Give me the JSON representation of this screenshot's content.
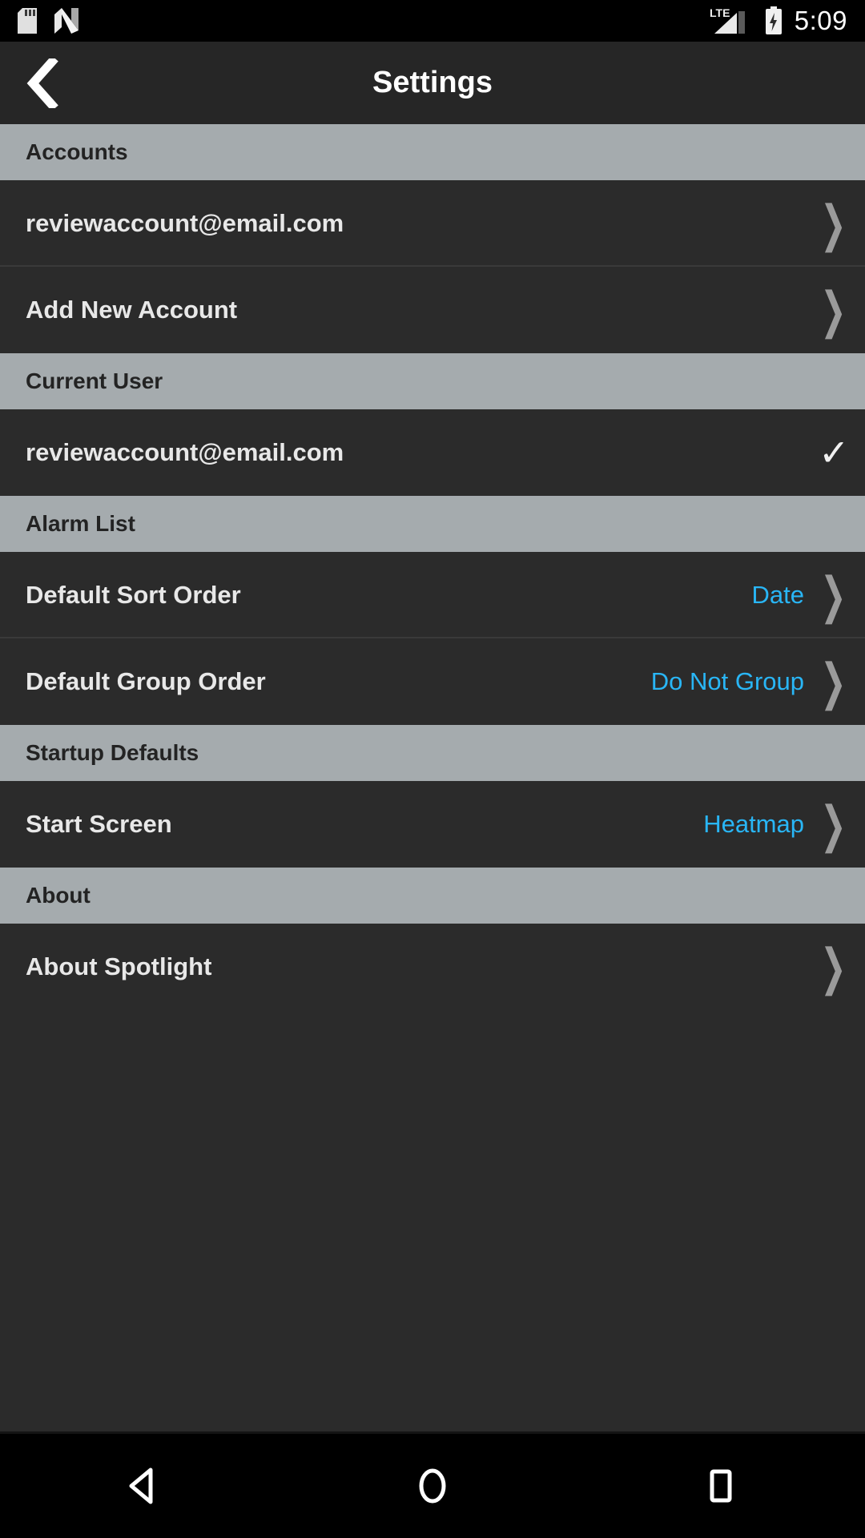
{
  "status_bar": {
    "time": "5:09",
    "icons": [
      "sd-card-icon",
      "android-nougat-icon",
      "lte-signal-icon",
      "battery-charging-icon"
    ],
    "network_label": "LTE"
  },
  "app_bar": {
    "back_label": "‹",
    "title": "Settings"
  },
  "colors": {
    "accent_blue": "#29b6f6",
    "section_header_bg": "#a5abae",
    "row_bg": "#2b2b2b",
    "appbar_bg": "#262626"
  },
  "sections": [
    {
      "header": "Accounts",
      "rows": [
        {
          "title": "reviewaccount@email.com",
          "value": "",
          "accessory": "chevron",
          "glyph": "❯"
        },
        {
          "title": "Add New Account",
          "value": "",
          "accessory": "chevron",
          "glyph": "❯"
        }
      ]
    },
    {
      "header": "Current User",
      "rows": [
        {
          "title": "reviewaccount@email.com",
          "value": "",
          "accessory": "check",
          "glyph": "✓"
        }
      ]
    },
    {
      "header": "Alarm List",
      "rows": [
        {
          "title": "Default Sort Order",
          "value": "Date",
          "accessory": "chevron",
          "glyph": "❯"
        },
        {
          "title": "Default Group Order",
          "value": "Do Not Group",
          "accessory": "chevron",
          "glyph": "❯"
        }
      ]
    },
    {
      "header": "Startup Defaults",
      "rows": [
        {
          "title": "Start Screen",
          "value": "Heatmap",
          "accessory": "chevron",
          "glyph": "❯"
        }
      ]
    },
    {
      "header": "About",
      "rows": [
        {
          "title": "About Spotlight",
          "value": "",
          "accessory": "chevron",
          "glyph": "❯"
        }
      ]
    }
  ],
  "nav_bar": {
    "back": "back-nav-icon",
    "home": "home-nav-icon",
    "recents": "recents-nav-icon"
  }
}
